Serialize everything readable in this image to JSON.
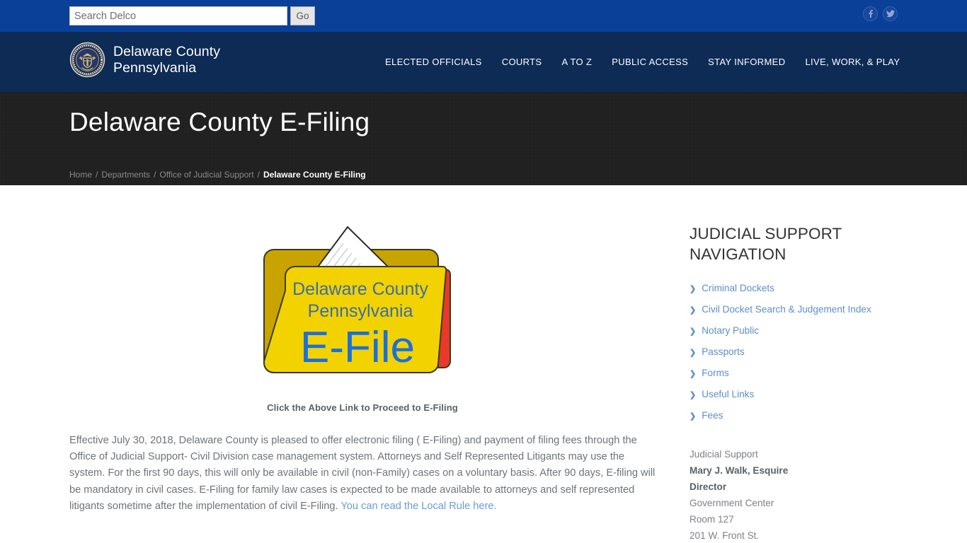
{
  "topbar": {
    "search": {
      "placeholder": "Search Delco",
      "value": ""
    },
    "go_label": "Go",
    "social": [
      {
        "name": "facebook-icon",
        "label": "f"
      },
      {
        "name": "twitter-icon",
        "label": "t"
      }
    ]
  },
  "header": {
    "brand": "Delaware County\nPennsylvania",
    "seal_alt": "county-seal",
    "nav": [
      {
        "label": "ELECTED OFFICIALS"
      },
      {
        "label": "COURTS"
      },
      {
        "label": "A TO Z"
      },
      {
        "label": "PUBLIC ACCESS"
      },
      {
        "label": "STAY INFORMED"
      },
      {
        "label": "LIVE, WORK, & PLAY"
      }
    ]
  },
  "banner": {
    "title": "Delaware County E-Filing",
    "breadcrumb": [
      {
        "label": "Home",
        "current": false
      },
      {
        "label": "Departments",
        "current": false
      },
      {
        "label": "Office of Judicial Support",
        "current": false
      },
      {
        "label": "Delaware County E-Filing",
        "current": true
      }
    ],
    "separator": "/"
  },
  "main": {
    "efile_image": {
      "line1": "Delaware County",
      "line2": "Pennsylvania",
      "line3": "E-File",
      "folder_color": "#f2d200",
      "folder_back_color": "#c9a400",
      "accent_color": "#e8392b",
      "text_color": "#3b6ea5",
      "title_color": "#1a6fe0"
    },
    "caption": "Click the Above Link to Proceed to E-Filing",
    "paragraph_part1": "Effective July 30, 2018, Delaware County is pleased to offer electronic filing ( E-Filing) and payment of filing fees through the Office of Judicial Support- Civil Division case management system. Attorneys and Self Represented Litigants may use the system. For the first 90 days, this will only be available in civil (non-Family) cases on a voluntary basis. After 90 days, E-filing will be mandatory in civil cases. E-Filing for family law cases is expected to be made available to attorneys and self represented litigants sometime after the implementation of civil E-Filing. ",
    "paragraph_link": "You can read the Local Rule here.",
    "link_color": "#6a9bdc"
  },
  "sidebar": {
    "title": "JUDICIAL SUPPORT NAVIGATION",
    "chevron": "❯",
    "items": [
      {
        "label": "Criminal Dockets"
      },
      {
        "label": "Civil Docket Search & Judgement Index"
      },
      {
        "label": "Notary Public"
      },
      {
        "label": "Passports"
      },
      {
        "label": "Forms"
      },
      {
        "label": "Useful Links"
      },
      {
        "label": "Fees"
      }
    ],
    "contact": {
      "dept": "Judicial Support",
      "name": "Mary J. Walk, Esquire",
      "role": "Director",
      "building": "Government Center",
      "room": "Room 127",
      "street": "201 W. Front St."
    }
  },
  "colors": {
    "topbar_blue": "#0b4098",
    "header_navy": "#0d2b55",
    "banner_dark": "#1a1a1a",
    "sidebar_link": "#5d8ec9"
  }
}
